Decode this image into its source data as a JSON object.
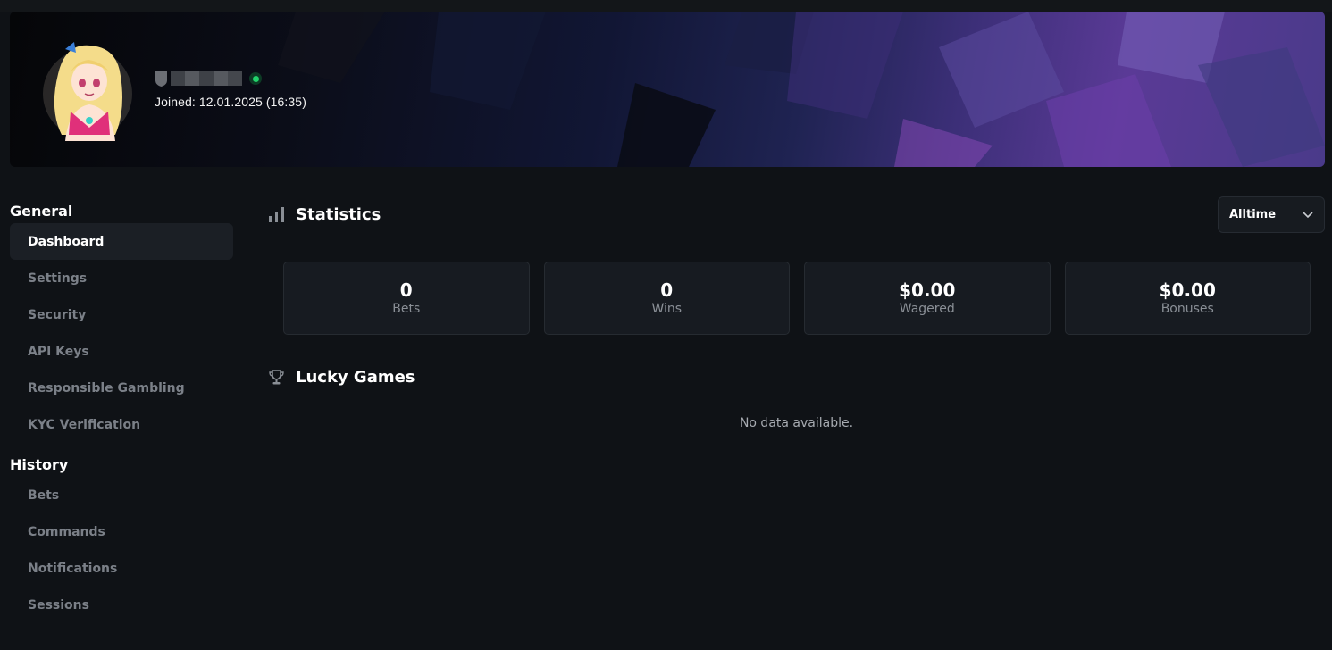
{
  "profile": {
    "joined": "Joined: 12.01.2025 (16:35)",
    "status": "online"
  },
  "sidebar": {
    "general_heading": "General",
    "general_items": [
      {
        "label": "Dashboard",
        "active": true
      },
      {
        "label": "Settings"
      },
      {
        "label": "Security"
      },
      {
        "label": "API Keys"
      },
      {
        "label": "Responsible Gambling"
      },
      {
        "label": "KYC Verification"
      }
    ],
    "history_heading": "History",
    "history_items": [
      {
        "label": "Bets"
      },
      {
        "label": "Commands"
      },
      {
        "label": "Notifications"
      },
      {
        "label": "Sessions"
      }
    ]
  },
  "statistics": {
    "title": "Statistics",
    "period": "Alltime",
    "cards": [
      {
        "value": "0",
        "label": "Bets"
      },
      {
        "value": "0",
        "label": "Wins"
      },
      {
        "value": "$0.00",
        "label": "Wagered"
      },
      {
        "value": "$0.00",
        "label": "Bonuses"
      }
    ]
  },
  "lucky_games": {
    "title": "Lucky Games",
    "empty_text": "No data available."
  },
  "colors": {
    "background": "#0f1216",
    "card": "#171b21",
    "muted_text": "#7b8088",
    "online": "#22d36b"
  }
}
